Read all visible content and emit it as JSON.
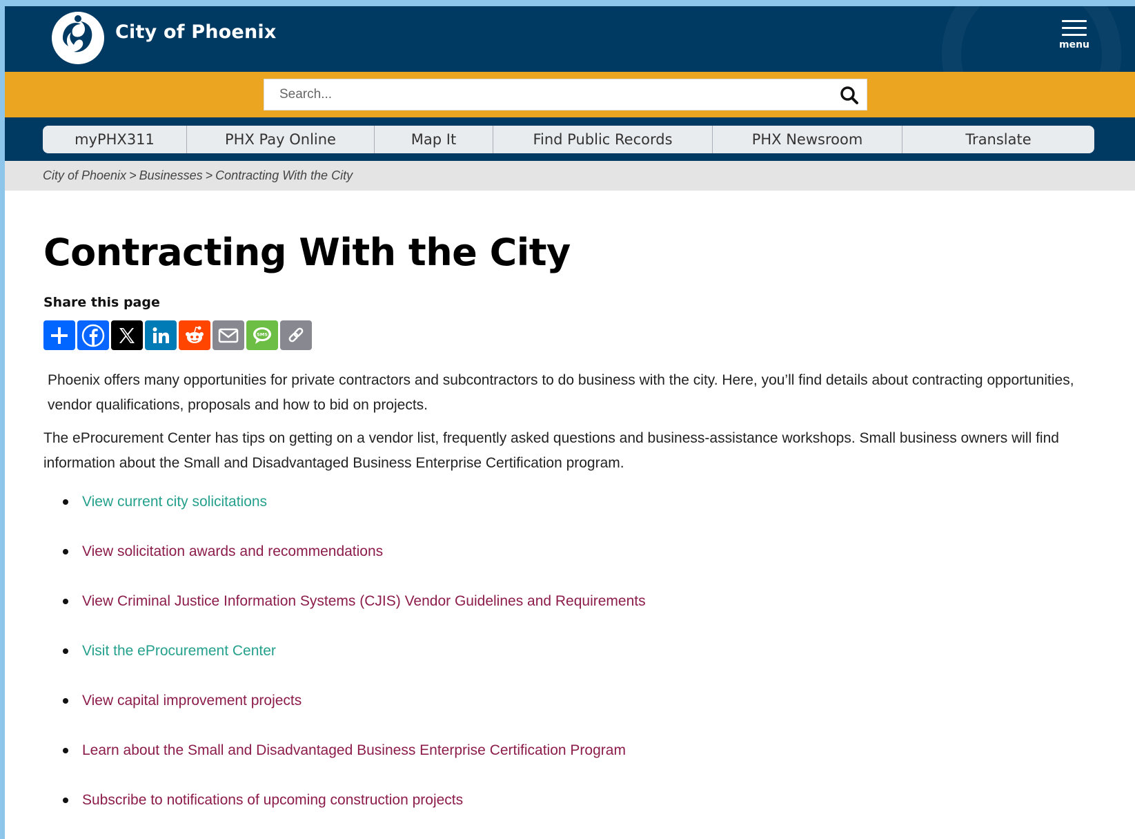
{
  "header": {
    "site_name": "City of Phoenix",
    "menu_label": "menu",
    "colors": {
      "navy": "#003a63",
      "gold": "#eca520"
    }
  },
  "search": {
    "placeholder": "Search..."
  },
  "quick_links": [
    {
      "label": "myPHX311"
    },
    {
      "label": "PHX Pay Online"
    },
    {
      "label": "Map It"
    },
    {
      "label": "Find Public Records"
    },
    {
      "label": "PHX Newsroom"
    },
    {
      "label": "Translate"
    }
  ],
  "breadcrumb": [
    {
      "label": "City of Phoenix"
    },
    {
      "label": "Businesses"
    },
    {
      "label": "Contracting With the City"
    }
  ],
  "main": {
    "title": "Contracting With the City",
    "share_label": "Share this page",
    "share_buttons": [
      {
        "name": "add-icon",
        "color": "#0166ff"
      },
      {
        "name": "facebook-icon",
        "color": "#0866ff"
      },
      {
        "name": "x-icon",
        "color": "#000000"
      },
      {
        "name": "linkedin-icon",
        "color": "#007bb5"
      },
      {
        "name": "reddit-icon",
        "color": "#ff4500"
      },
      {
        "name": "email-icon",
        "color": "#888990"
      },
      {
        "name": "sms-icon",
        "color": "#6cbe45"
      },
      {
        "name": "copy-link-icon",
        "color": "#888990"
      }
    ],
    "paragraphs": [
      "Phoenix offers many opportunities for private contractors and subcontractors to do business with the city. Here, you’ll find details about contracting opportunities, vendor qualifications, proposals and how to bid on projects.",
      "The eProcurement Center has tips on getting on a vendor list, frequently asked questions and business-assistance workshops. Small business owners will find information about the Small and Disadvantaged Business Enterprise Certification program."
    ],
    "links": [
      {
        "label": "View current city solicitations",
        "color": "#24a08c"
      },
      {
        "label": "View solicitation awards and recommendations",
        "color": "#8c1c4a"
      },
      {
        "label": "View Criminal Justice Information Systems (CJIS) Vendor Guidelines and Requirements",
        "color": "#8c1c4a"
      },
      {
        "label": "Visit the eProcurement Center",
        "color": "#24a08c"
      },
      {
        "label": "View capital improvement projects",
        "color": "#8c1c4a"
      },
      {
        "label": "Learn about the Small and Disadvantaged Business Enterprise Certification Program",
        "color": "#8c1c4a"
      },
      {
        "label": "Subscribe to notifications of upcoming construction projects",
        "color": "#8c1c4a"
      }
    ]
  }
}
